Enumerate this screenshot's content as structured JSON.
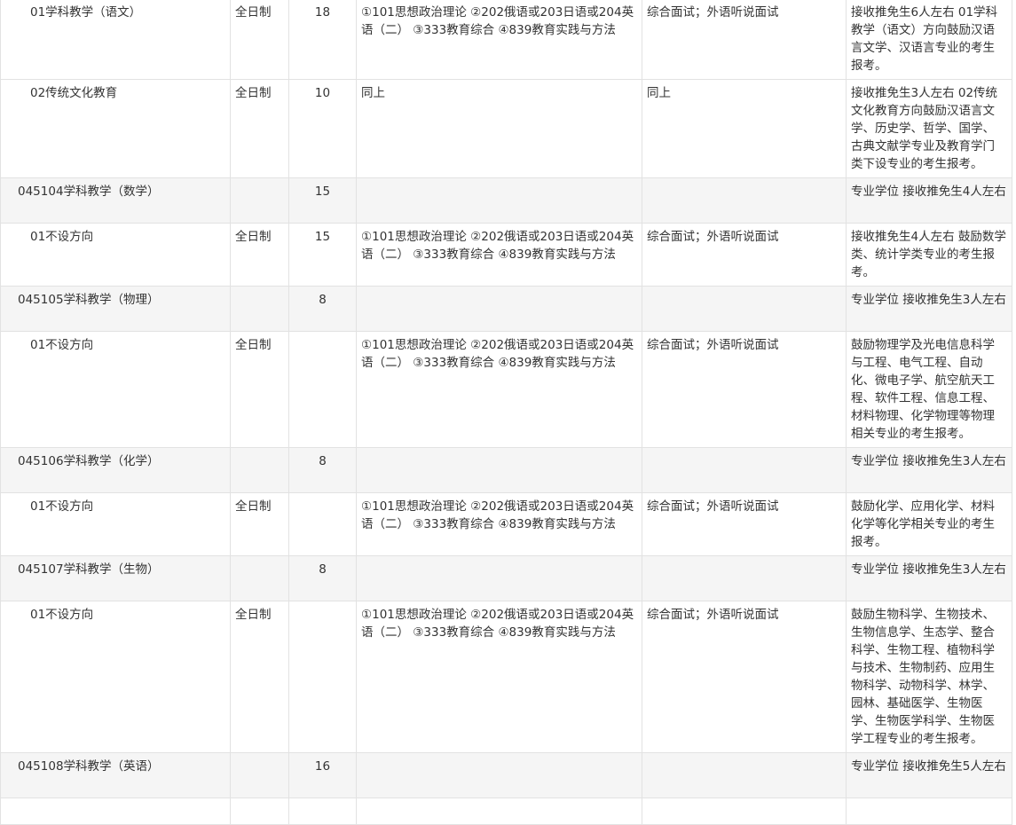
{
  "rows": [
    {
      "type": "direction",
      "name": "01学科教学（语文）",
      "mode": "全日制",
      "count": "18",
      "exam": "①101思想政治理论 ②202俄语或203日语或204英语（二） ③333教育综合 ④839教育实践与方法",
      "retest": "综合面试；外语听说面试",
      "remark": "接收推免生6人左右 01学科教学（语文）方向鼓励汉语言文学、汉语言专业的考生报考。"
    },
    {
      "type": "direction",
      "name": "02传统文化教育",
      "mode": "全日制",
      "count": "10",
      "exam": "同上",
      "retest": "同上",
      "remark": "接收推免生3人左右 02传统文化教育方向鼓励汉语言文学、历史学、哲学、国学、古典文献学专业及教育学门类下设专业的考生报考。"
    },
    {
      "type": "major",
      "name": "045104学科教学（数学）",
      "mode": "",
      "count": "15",
      "exam": "",
      "retest": "",
      "remark": "专业学位 接收推免生4人左右"
    },
    {
      "type": "direction",
      "name": "01不设方向",
      "mode": "全日制",
      "count": "15",
      "exam": "①101思想政治理论 ②202俄语或203日语或204英语（二） ③333教育综合 ④839教育实践与方法",
      "retest": "综合面试；外语听说面试",
      "remark": "接收推免生4人左右 鼓励数学类、统计学类专业的考生报考。"
    },
    {
      "type": "major",
      "name": "045105学科教学（物理）",
      "mode": "",
      "count": "8",
      "exam": "",
      "retest": "",
      "remark": "专业学位 接收推免生3人左右"
    },
    {
      "type": "direction",
      "name": "01不设方向",
      "mode": "全日制",
      "count": "",
      "exam": "①101思想政治理论 ②202俄语或203日语或204英语（二） ③333教育综合 ④839教育实践与方法",
      "retest": "综合面试；外语听说面试",
      "remark": "鼓励物理学及光电信息科学与工程、电气工程、自动化、微电子学、航空航天工程、软件工程、信息工程、材料物理、化学物理等物理相关专业的考生报考。"
    },
    {
      "type": "major",
      "name": "045106学科教学（化学）",
      "mode": "",
      "count": "8",
      "exam": "",
      "retest": "",
      "remark": "专业学位 接收推免生3人左右"
    },
    {
      "type": "direction",
      "name": "01不设方向",
      "mode": "全日制",
      "count": "",
      "exam": "①101思想政治理论 ②202俄语或203日语或204英语（二） ③333教育综合 ④839教育实践与方法",
      "retest": "综合面试；外语听说面试",
      "remark": "鼓励化学、应用化学、材料化学等化学相关专业的考生报考。"
    },
    {
      "type": "major",
      "name": "045107学科教学（生物）",
      "mode": "",
      "count": "8",
      "exam": "",
      "retest": "",
      "remark": "专业学位 接收推免生3人左右"
    },
    {
      "type": "direction",
      "name": "01不设方向",
      "mode": "全日制",
      "count": "",
      "exam": "①101思想政治理论 ②202俄语或203日语或204英语（二） ③333教育综合 ④839教育实践与方法",
      "retest": "综合面试；外语听说面试",
      "remark": "鼓励生物科学、生物技术、生物信息学、生态学、整合科学、生物工程、植物科学与技术、生物制药、应用生物科学、动物科学、林学、园林、基础医学、生物医学、生物医学科学、生物医学工程专业的考生报考。"
    },
    {
      "type": "major",
      "name": "045108学科教学（英语）",
      "mode": "",
      "count": "16",
      "exam": "",
      "retest": "",
      "remark": "专业学位 接收推免生5人左右"
    },
    {
      "type": "direction",
      "name": "",
      "mode": "",
      "count": "",
      "exam": "",
      "retest": "",
      "remark": ""
    }
  ]
}
